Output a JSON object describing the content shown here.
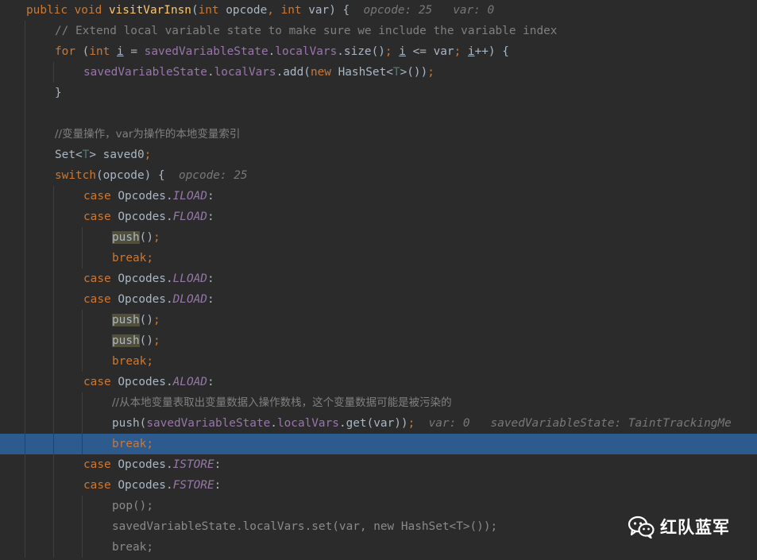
{
  "editor": {
    "language": "java",
    "colors": {
      "background": "#2b2b2b",
      "keyword": "#cc7832",
      "method": "#ffc66d",
      "field": "#9876aa",
      "comment": "#808080",
      "inlay_hint": "#787878",
      "type_param": "#507874",
      "current_line": "#2d5b8e",
      "usage_highlight": "#52503a"
    },
    "current_line_index": 21,
    "lines": [
      {
        "indent": 0,
        "tokens": [
          {
            "t": "public void ",
            "c": "kw"
          },
          {
            "t": "visitVarInsn",
            "c": "fn"
          },
          {
            "t": "(",
            "c": ""
          },
          {
            "t": "int ",
            "c": "kw"
          },
          {
            "t": "opcode",
            "c": ""
          },
          {
            "t": ", ",
            "c": "kw"
          },
          {
            "t": "int ",
            "c": "kw"
          },
          {
            "t": "var",
            "c": ""
          },
          {
            "t": ") {",
            "c": ""
          },
          {
            "t": "  opcode: 25   var: 0",
            "c": "hint"
          }
        ]
      },
      {
        "indent": 1,
        "tokens": [
          {
            "t": "// Extend local variable state to make sure we include the variable index",
            "c": "cmt"
          }
        ]
      },
      {
        "indent": 1,
        "tokens": [
          {
            "t": "for ",
            "c": "kw"
          },
          {
            "t": "(",
            "c": ""
          },
          {
            "t": "int ",
            "c": "kw"
          },
          {
            "t": "i",
            "c": "ul"
          },
          {
            "t": " = ",
            "c": ""
          },
          {
            "t": "savedVariableState",
            "c": "field"
          },
          {
            "t": ".",
            "c": ""
          },
          {
            "t": "localVars",
            "c": "field"
          },
          {
            "t": ".size()",
            "c": ""
          },
          {
            "t": "; ",
            "c": "kw"
          },
          {
            "t": "i",
            "c": "ul"
          },
          {
            "t": " <= var",
            "c": ""
          },
          {
            "t": "; ",
            "c": "kw"
          },
          {
            "t": "i",
            "c": "ul"
          },
          {
            "t": "++) {",
            "c": ""
          }
        ]
      },
      {
        "indent": 2,
        "tokens": [
          {
            "t": "savedVariableState",
            "c": "field"
          },
          {
            "t": ".",
            "c": ""
          },
          {
            "t": "localVars",
            "c": "field"
          },
          {
            "t": ".add(",
            "c": ""
          },
          {
            "t": "new ",
            "c": "kw"
          },
          {
            "t": "HashSet<",
            "c": ""
          },
          {
            "t": "T",
            "c": "tparam"
          },
          {
            "t": ">())",
            "c": ""
          },
          {
            "t": ";",
            "c": "kw"
          }
        ]
      },
      {
        "indent": 1,
        "tokens": [
          {
            "t": "}",
            "c": ""
          }
        ]
      },
      {
        "indent": 1,
        "tokens": []
      },
      {
        "indent": 1,
        "tokens": [
          {
            "t": "//变量操作，var为操作的本地变量索引",
            "c": "cmt cjk"
          }
        ]
      },
      {
        "indent": 1,
        "tokens": [
          {
            "t": "Set<",
            "c": ""
          },
          {
            "t": "T",
            "c": "tparam"
          },
          {
            "t": "> saved0",
            "c": ""
          },
          {
            "t": ";",
            "c": "kw"
          }
        ]
      },
      {
        "indent": 1,
        "tokens": [
          {
            "t": "switch",
            "c": "kw"
          },
          {
            "t": "(opcode) {",
            "c": ""
          },
          {
            "t": "  opcode: 25",
            "c": "hint"
          }
        ]
      },
      {
        "indent": 2,
        "tokens": [
          {
            "t": "case ",
            "c": "kw"
          },
          {
            "t": "Opcodes.",
            "c": ""
          },
          {
            "t": "ILOAD",
            "c": "const"
          },
          {
            "t": ":",
            "c": ""
          }
        ]
      },
      {
        "indent": 2,
        "tokens": [
          {
            "t": "case ",
            "c": "kw"
          },
          {
            "t": "Opcodes.",
            "c": ""
          },
          {
            "t": "FLOAD",
            "c": "const"
          },
          {
            "t": ":",
            "c": ""
          }
        ]
      },
      {
        "indent": 3,
        "tokens": [
          {
            "t": "push",
            "c": "hl"
          },
          {
            "t": "()",
            "c": ""
          },
          {
            "t": ";",
            "c": "kw"
          }
        ]
      },
      {
        "indent": 3,
        "tokens": [
          {
            "t": "break;",
            "c": "kw"
          }
        ]
      },
      {
        "indent": 2,
        "tokens": [
          {
            "t": "case ",
            "c": "kw"
          },
          {
            "t": "Opcodes.",
            "c": ""
          },
          {
            "t": "LLOAD",
            "c": "const"
          },
          {
            "t": ":",
            "c": ""
          }
        ]
      },
      {
        "indent": 2,
        "tokens": [
          {
            "t": "case ",
            "c": "kw"
          },
          {
            "t": "Opcodes.",
            "c": ""
          },
          {
            "t": "DLOAD",
            "c": "const"
          },
          {
            "t": ":",
            "c": ""
          }
        ]
      },
      {
        "indent": 3,
        "tokens": [
          {
            "t": "push",
            "c": "hl"
          },
          {
            "t": "()",
            "c": ""
          },
          {
            "t": ";",
            "c": "kw"
          }
        ]
      },
      {
        "indent": 3,
        "tokens": [
          {
            "t": "push",
            "c": "hl"
          },
          {
            "t": "()",
            "c": ""
          },
          {
            "t": ";",
            "c": "kw"
          }
        ]
      },
      {
        "indent": 3,
        "tokens": [
          {
            "t": "break;",
            "c": "kw"
          }
        ]
      },
      {
        "indent": 2,
        "tokens": [
          {
            "t": "case ",
            "c": "kw"
          },
          {
            "t": "Opcodes.",
            "c": ""
          },
          {
            "t": "ALOAD",
            "c": "const"
          },
          {
            "t": ":",
            "c": ""
          }
        ]
      },
      {
        "indent": 3,
        "tokens": [
          {
            "t": "//从本地变量表取出变量数据入操作数栈，这个变量数据可能是被污染的",
            "c": "cmt cjk"
          }
        ]
      },
      {
        "indent": 3,
        "tokens": [
          {
            "t": "push(",
            "c": ""
          },
          {
            "t": "savedVariableState",
            "c": "field"
          },
          {
            "t": ".",
            "c": ""
          },
          {
            "t": "localVars",
            "c": "field"
          },
          {
            "t": ".get(var))",
            "c": ""
          },
          {
            "t": ";",
            "c": "kw"
          },
          {
            "t": "  var: 0   savedVariableState: TaintTrackingMe",
            "c": "hint"
          }
        ]
      },
      {
        "indent": 3,
        "tokens": [
          {
            "t": "break;",
            "c": "kw"
          }
        ]
      },
      {
        "indent": 2,
        "tokens": [
          {
            "t": "case ",
            "c": "kw"
          },
          {
            "t": "Opcodes.",
            "c": ""
          },
          {
            "t": "ISTORE",
            "c": "const"
          },
          {
            "t": ":",
            "c": ""
          }
        ]
      },
      {
        "indent": 2,
        "tokens": [
          {
            "t": "case ",
            "c": "kw"
          },
          {
            "t": "Opcodes.",
            "c": ""
          },
          {
            "t": "FSTORE",
            "c": "const"
          },
          {
            "t": ":",
            "c": ""
          }
        ]
      },
      {
        "indent": 3,
        "tokens": [
          {
            "t": "pop();",
            "c": "gray"
          }
        ]
      },
      {
        "indent": 3,
        "tokens": [
          {
            "t": "savedVariableState.localVars.set(var, new HashSet<T>());",
            "c": "gray"
          }
        ]
      },
      {
        "indent": 3,
        "tokens": [
          {
            "t": "break;",
            "c": "gray"
          }
        ]
      }
    ]
  },
  "watermark": {
    "icon": "wechat-icon",
    "text": "红队蓝军"
  }
}
